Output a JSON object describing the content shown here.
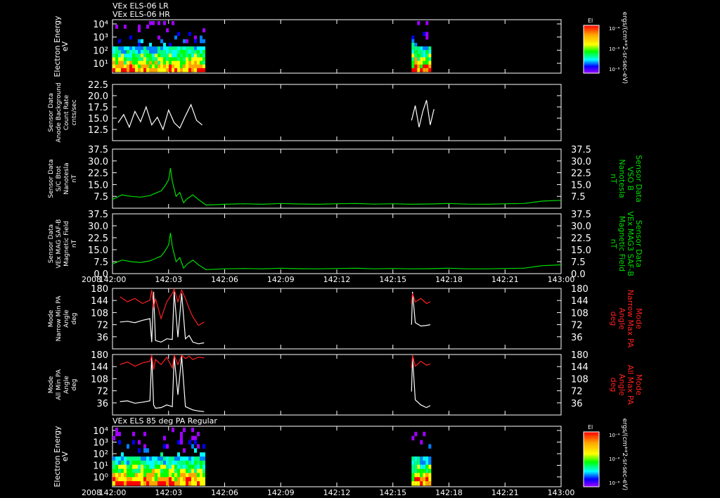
{
  "header": {
    "line1": "VEx ELS-06 LR",
    "line2": "VEx ELS-06 HR"
  },
  "time_axis": {
    "year": "2008",
    "ticks": [
      "142:00",
      "142:03",
      "142:06",
      "142:09",
      "142:12",
      "142:15",
      "142:18",
      "142:21",
      "143:00"
    ]
  },
  "colors": {
    "background": "#000000",
    "axis": "#ffffff",
    "trace_white": "#ffffff",
    "trace_green": "#00dd00",
    "trace_red": "#ff2020"
  },
  "chart_data": [
    {
      "type": "heatmap",
      "ylabel": [
        "Electron Energy",
        "eV"
      ],
      "yticks": [
        "10⁴",
        "10³",
        "10²",
        "10¹"
      ],
      "yscale": "log",
      "colorbar": {
        "title": "El",
        "unit": "ergs/(cm**2-sr-sec-eV)",
        "ticks": [
          "10⁻⁴",
          "10⁻⁶",
          "10⁻⁸"
        ]
      },
      "data_intervals": [
        [
          "142:00",
          "142:05"
        ],
        [
          "142:16",
          "142:17"
        ]
      ]
    },
    {
      "type": "line",
      "ylabel": [
        "Sensor Data",
        "Anode Background",
        "Count Rate",
        "cnts/sec"
      ],
      "yticks": [
        "22.5",
        "20.0",
        "17.5",
        "15.0",
        "12.5"
      ],
      "ylim": [
        10,
        22.5
      ],
      "series": [
        {
          "color": "#ffffff",
          "segments": [
            {
              "x": [
                0.3,
                0.6,
                0.9,
                1.2,
                1.5,
                1.8,
                2.1,
                2.4,
                2.7,
                3.0,
                3.3,
                3.6,
                3.9,
                4.2,
                4.5,
                4.8
              ],
              "y": [
                14.0,
                15.8,
                13.0,
                16.5,
                14.2,
                17.5,
                13.5,
                15.2,
                12.5,
                16.8,
                14.0,
                12.8,
                15.5,
                18.0,
                14.5,
                13.5
              ]
            },
            {
              "x": [
                16.0,
                16.2,
                16.4,
                16.6,
                16.8,
                17.0,
                17.2
              ],
              "y": [
                14.5,
                17.8,
                13.0,
                16.5,
                19.0,
                13.5,
                17.0
              ]
            }
          ]
        }
      ]
    },
    {
      "type": "line",
      "ylabel": [
        "Sensor Data",
        "S/C Btot",
        "Nanotesla",
        "nT"
      ],
      "rlabel": [
        "Sensor Data",
        "VSO B",
        "Nanotesla",
        "nT"
      ],
      "yticks": [
        "37.5",
        "30.0",
        "22.5",
        "15.0",
        "7.5"
      ],
      "ylim": [
        0,
        37.5
      ],
      "series": [
        {
          "color": "#00dd00",
          "segments": [
            {
              "x": [
                0,
                0.5,
                1.0,
                1.5,
                2.0,
                2.3,
                2.6,
                2.8,
                3.0,
                3.1,
                3.2,
                3.4,
                3.6,
                3.8,
                4.0,
                4.3,
                4.6,
                5.0,
                6,
                7,
                8,
                9,
                10,
                11,
                12,
                13,
                14,
                15,
                16,
                17,
                18,
                19,
                20,
                21,
                22,
                23,
                24
              ],
              "y": [
                5.5,
                8.5,
                7.5,
                7.0,
                8.0,
                9.5,
                11.0,
                14.0,
                18.0,
                25.5,
                17.0,
                7.5,
                10.0,
                3.5,
                6.0,
                8.5,
                5.5,
                2.0,
                2.5,
                2.8,
                2.5,
                3.0,
                2.7,
                2.5,
                2.8,
                3.0,
                2.6,
                2.8,
                2.5,
                2.7,
                3.0,
                2.6,
                2.5,
                2.8,
                3.0,
                4.5,
                5.0
              ]
            }
          ]
        }
      ]
    },
    {
      "type": "line",
      "ylabel": [
        "Sensor Data",
        "VEx MAG SAF-B",
        "Magnetic Field",
        "nT"
      ],
      "rlabel": [
        "Sensor Data",
        "VEx MAG3 SAF-B",
        "Magnetic Field",
        "nT"
      ],
      "yticks": [
        "37.5",
        "30.0",
        "22.5",
        "15.0",
        "7.5",
        "0.0"
      ],
      "ylim": [
        0,
        37.5
      ],
      "series": [
        {
          "color": "#00dd00",
          "segments": [
            {
              "x": [
                0,
                0.5,
                1.0,
                1.5,
                2.0,
                2.3,
                2.6,
                2.8,
                3.0,
                3.1,
                3.2,
                3.4,
                3.6,
                3.8,
                4.0,
                4.3,
                4.6,
                5.0,
                6,
                7,
                8,
                9,
                10,
                11,
                12,
                13,
                14,
                15,
                16,
                17,
                18,
                19,
                20,
                21,
                22,
                23,
                24
              ],
              "y": [
                6.0,
                8.5,
                7.5,
                7.0,
                8.0,
                9.5,
                11.0,
                14.0,
                18.0,
                25.5,
                17.0,
                7.5,
                10.0,
                3.5,
                6.0,
                8.5,
                5.5,
                2.5,
                3.0,
                3.2,
                3.0,
                3.4,
                3.1,
                3.0,
                3.2,
                3.4,
                3.0,
                3.2,
                3.0,
                3.1,
                3.4,
                3.0,
                3.0,
                3.2,
                3.4,
                5.0,
                5.5
              ]
            }
          ]
        }
      ]
    },
    {
      "type": "line",
      "ylabel": [
        "Mode",
        "Narrow Min PA",
        "Angle",
        "deg"
      ],
      "rlabel": [
        "Mode",
        "Narrow Max PA",
        "Angle",
        "deg"
      ],
      "yticks": [
        "180",
        "144",
        "108",
        "72",
        "36"
      ],
      "ylim": [
        0,
        180
      ],
      "series": [
        {
          "color": "#ffffff",
          "segments": [
            {
              "x": [
                0.4,
                0.8,
                1.2,
                1.6,
                2.0,
                2.1,
                2.2,
                2.3,
                2.6,
                2.9,
                3.2,
                3.3,
                3.5,
                3.7,
                3.9,
                4.1,
                4.3,
                4.6,
                4.9
              ],
              "y": [
                80,
                82,
                78,
                85,
                90,
                20,
                170,
                25,
                20,
                30,
                28,
                170,
                35,
                165,
                30,
                40,
                20,
                15,
                18
              ]
            },
            {
              "x": [
                16.0,
                16.05,
                16.2,
                16.5,
                16.8,
                17.0
              ],
              "y": [
                72,
                170,
                78,
                68,
                70,
                72
              ]
            }
          ]
        },
        {
          "color": "#ff2020",
          "segments": [
            {
              "x": [
                0.4,
                0.8,
                1.2,
                1.6,
                2.0,
                2.1,
                2.2,
                2.3,
                2.6,
                2.9,
                3.2,
                3.3,
                3.5,
                3.7,
                3.9,
                4.1,
                4.3,
                4.6,
                4.9
              ],
              "y": [
                155,
                140,
                150,
                135,
                145,
                175,
                120,
                150,
                90,
                140,
                165,
                178,
                140,
                175,
                150,
                120,
                95,
                70,
                80
              ]
            },
            {
              "x": [
                16.0,
                16.05,
                16.2,
                16.5,
                16.8,
                17.0
              ],
              "y": [
                135,
                165,
                140,
                150,
                135,
                140
              ]
            }
          ]
        }
      ]
    },
    {
      "type": "line",
      "ylabel": [
        "Mode",
        "All Min PA",
        "Angle",
        "deg"
      ],
      "rlabel": [
        "Mode",
        "All Max PA",
        "Angle",
        "deg"
      ],
      "yticks": [
        "180",
        "144",
        "108",
        "72",
        "36"
      ],
      "ylim": [
        0,
        180
      ],
      "series": [
        {
          "color": "#ffffff",
          "segments": [
            {
              "x": [
                0.4,
                0.8,
                1.2,
                1.6,
                2.0,
                2.1,
                2.2,
                2.3,
                2.6,
                2.9,
                3.2,
                3.3,
                3.5,
                3.7,
                3.9,
                4.1,
                4.3,
                4.6,
                4.9
              ],
              "y": [
                40,
                42,
                35,
                38,
                42,
                175,
                30,
                20,
                22,
                30,
                25,
                175,
                60,
                175,
                25,
                20,
                15,
                12,
                10
              ]
            },
            {
              "x": [
                16.0,
                16.05,
                16.2,
                16.5,
                16.8,
                17.0
              ],
              "y": [
                70,
                175,
                45,
                30,
                22,
                28
              ]
            }
          ]
        },
        {
          "color": "#ff2020",
          "segments": [
            {
              "x": [
                0.4,
                0.8,
                1.2,
                1.6,
                2.0,
                2.1,
                2.2,
                2.3,
                2.6,
                2.9,
                3.2,
                3.3,
                3.5,
                3.7,
                3.9,
                4.1,
                4.3,
                4.6,
                4.9
              ],
              "y": [
                150,
                158,
                145,
                155,
                160,
                178,
                135,
                165,
                150,
                172,
                140,
                178,
                150,
                178,
                168,
                175,
                165,
                172,
                170
              ]
            },
            {
              "x": [
                16.0,
                16.05,
                16.2,
                16.5,
                16.8,
                17.0
              ],
              "y": [
                140,
                178,
                145,
                160,
                148,
                152
              ]
            }
          ]
        }
      ]
    },
    {
      "type": "heatmap",
      "title": "VEx ELS 85 deg PA Regular",
      "ylabel": [
        "Electron Energy",
        "eV"
      ],
      "yticks": [
        "10⁴",
        "10³",
        "10²",
        "10¹",
        "10⁰"
      ],
      "yscale": "log",
      "colorbar": {
        "title": "El",
        "unit": "ergs/(cm**2-sr-sec-eV)",
        "ticks": [
          "10⁻⁴",
          "10⁻⁶",
          "10⁻⁸"
        ]
      },
      "data_intervals": [
        [
          "142:00",
          "142:05"
        ],
        [
          "142:16",
          "142:17"
        ]
      ]
    }
  ]
}
